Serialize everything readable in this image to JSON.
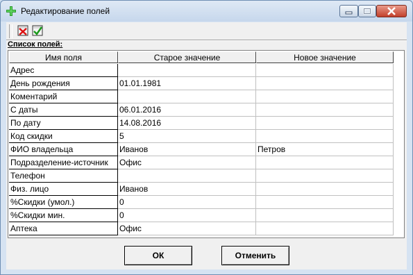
{
  "window": {
    "title": "Редактирование полей"
  },
  "toolbar": {
    "buttons": [
      {
        "icon": "cancel-icon"
      },
      {
        "icon": "apply-icon"
      }
    ]
  },
  "list_label": "Список полей:",
  "table": {
    "columns": [
      "Имя поля",
      "Старое значение",
      "Новое значение"
    ],
    "rows": [
      {
        "name": "Адрес",
        "old": "",
        "new": ""
      },
      {
        "name": "День рождения",
        "old": "01.01.1981",
        "new": ""
      },
      {
        "name": "Коментарий",
        "old": "",
        "new": ""
      },
      {
        "name": "С даты",
        "old": "06.01.2016",
        "new": ""
      },
      {
        "name": "По дату",
        "old": "14.08.2016",
        "new": ""
      },
      {
        "name": "Код скидки",
        "old": "5",
        "new": ""
      },
      {
        "name": "ФИО владельца",
        "old": "Иванов",
        "new": "Петров"
      },
      {
        "name": "Подразделение-источник",
        "old": "Офис",
        "new": ""
      },
      {
        "name": "Телефон",
        "old": "",
        "new": ""
      },
      {
        "name": "Физ. лицо",
        "old": "Иванов",
        "new": ""
      },
      {
        "name": "%Скидки (умол.)",
        "old": "0",
        "new": ""
      },
      {
        "name": "%Скидки мин.",
        "old": "0",
        "new": ""
      },
      {
        "name": "Аптека",
        "old": "Офис",
        "new": ""
      }
    ]
  },
  "buttons": {
    "ok": "ОК",
    "cancel": "Отменить"
  }
}
